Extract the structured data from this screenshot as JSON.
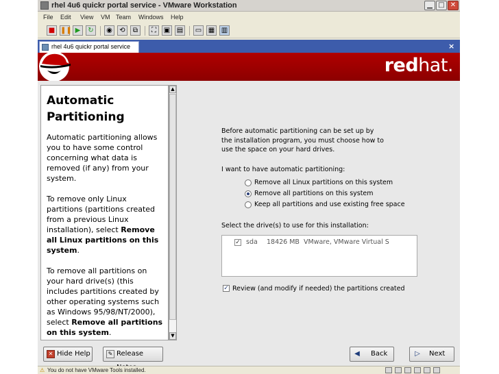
{
  "window": {
    "title": "rhel 4u6 quickr portal service - VMware Workstation",
    "controls": [
      "minimize-icon",
      "maximize-icon",
      "close-icon"
    ]
  },
  "menu": {
    "items": [
      "File",
      "Edit",
      "View",
      "VM",
      "Team",
      "Windows",
      "Help"
    ]
  },
  "toolbar": {
    "icons": [
      "stop-icon",
      "pause-icon",
      "play-icon",
      "reset-icon",
      "snapshot-icon",
      "revert-icon",
      "snapshot-manager-icon",
      "fullscreen-icon",
      "quick-switch-icon",
      "summary-icon",
      "console-view-icon",
      "appliance-view-icon",
      "thumbnail-icon"
    ]
  },
  "tab": {
    "label": "rhel 4u6 quickr portal service",
    "close_glyph": "×"
  },
  "banner": {
    "brand_bold": "red",
    "brand_light": "hat."
  },
  "help": {
    "title": "Automatic Partitioning",
    "para1": "Automatic partitioning allows you to have some control concerning what data is removed (if any) from your system.",
    "para2_pre": "To remove only Linux partitions (partitions created from a previous Linux installation), select ",
    "para2_bold": "Remove all Linux partitions on this system",
    "para2_post": ".",
    "para3_pre": "To remove all partitions on your hard drive(s) (this includes partitions created by other operating systems such as Windows 95/98/NT/2000), select ",
    "para3_bold": "Remove all partitions on this system",
    "para3_post": "."
  },
  "main": {
    "intro": "Before automatic partitioning can be set up by the installation program, you must choose how to use the space on your hard drives.",
    "question": "I want to have automatic partitioning:",
    "options": [
      {
        "label": "Remove all Linux partitions on this system",
        "selected": false
      },
      {
        "label": "Remove all partitions on this system",
        "selected": true
      },
      {
        "label": "Keep all partitions and use existing free space",
        "selected": false
      }
    ],
    "drives_label": "Select the drive(s) to use for this installation:",
    "drives": [
      {
        "checked": true,
        "name": "sda",
        "size": "18426 MB",
        "model": "VMware, VMware Virtual S"
      }
    ],
    "review_label": "Review (and modify if needed) the partitions created",
    "review_checked": true
  },
  "buttons": {
    "hide_help": "Hide Help",
    "release_notes": "Release Notes",
    "back": "Back",
    "next": "Next"
  },
  "status": {
    "message": "You do not have VMware Tools installed."
  }
}
